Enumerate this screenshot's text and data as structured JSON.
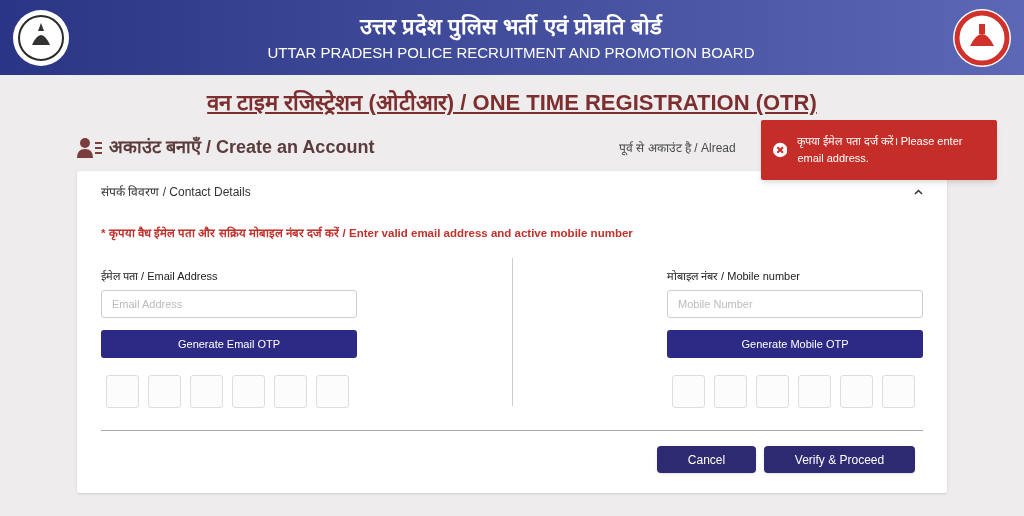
{
  "header": {
    "title_hindi": "उत्तर प्रदेश पुलिस भर्ती एवं प्रोन्नति बोर्ड",
    "title_english": "UTTAR PRADESH POLICE RECRUITMENT AND PROMOTION BOARD"
  },
  "page_title": "वन टाइम रजिस्ट्रेशन (ओटीआर) / ONE TIME REGISTRATION (OTR)",
  "section_heading": "अकाउंट बनाएँ / Create an Account",
  "login_link": "पूर्व से अकाउंट है / Alread",
  "toast": {
    "message": "कृपया ईमेल पता दर्ज करें। Please enter email address."
  },
  "card": {
    "title": "संपर्क विवरण / Contact Details",
    "expanded": true,
    "notice": "* कृपया वैध ईमेल पता और सक्रिय मोबाइल नंबर दर्ज करें / Enter valid email address and active mobile number",
    "columns": [
      {
        "label": "ईमेल पता / Email Address",
        "placeholder": "Email Address",
        "button": "Generate Email OTP"
      },
      {
        "label": "मोबाइल नंबर / Mobile number",
        "placeholder": "Mobile Number",
        "button": "Generate Mobile OTP"
      }
    ],
    "buttons": [
      "Cancel",
      "Verify & Proceed"
    ]
  }
}
